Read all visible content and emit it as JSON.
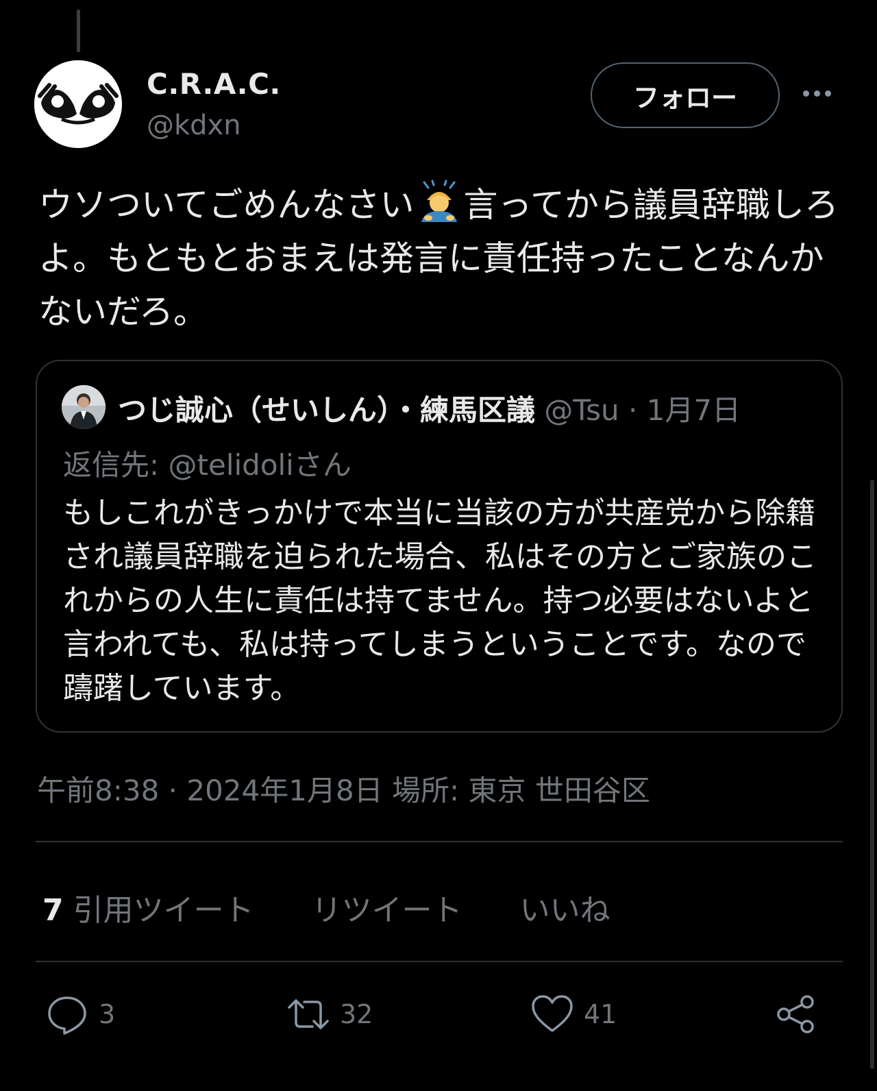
{
  "author": {
    "display_name": "C.R.A.C.",
    "handle": "@kdxn"
  },
  "header": {
    "follow_label": "フォロー",
    "more_icon": "more-horizontal-icon"
  },
  "tweet": {
    "text_part1": "ウソついてごめんなさい",
    "emoji": "person-bowing-emoji",
    "text_part2": "言ってから議員辞職しろよ。もともとおまえは発言に責任持ったことなんかないだろ。"
  },
  "quote": {
    "author_name": "つじ誠心（せいしん）・練馬区議",
    "handle": "@Tsu",
    "date": "1月7日",
    "reply_label": "返信先:",
    "reply_to": "@telidoliさん",
    "text": "もしこれがきっかけで本当に当該の方が共産党から除籍され議員辞職を迫られた場合、私はその方とご家族のこれからの人生に責任は持てません。持つ必要はないよと言われても、私は持ってしまうということです。なので躊躇しています。"
  },
  "meta": {
    "timestamp": "午前8:38 · 2024年1月8日 場所: 東京 世田谷区"
  },
  "stats": {
    "quote_count": "7",
    "quote_label": "引用ツイート",
    "retweet_label": "リツイート",
    "like_label": "いいね"
  },
  "actions": {
    "reply_count": "3",
    "retweet_count": "32",
    "like_count": "41"
  },
  "colors": {
    "background": "#000000",
    "text": "#e7e9ea",
    "secondary": "#71767b",
    "border": "#2f3336"
  }
}
